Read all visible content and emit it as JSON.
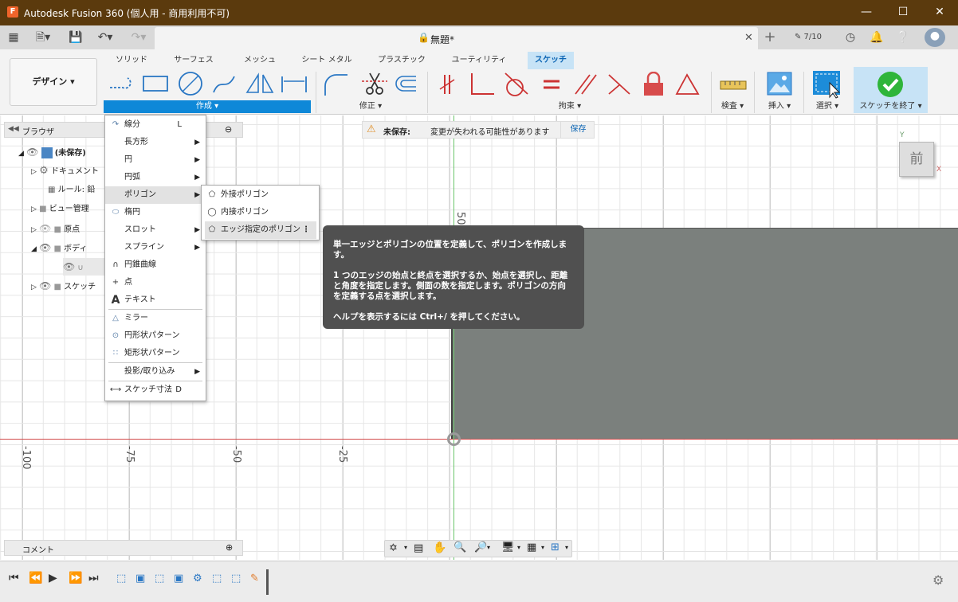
{
  "window": {
    "title": "Autodesk Fusion 360 (個人用 - 商用利用不可)"
  },
  "tabbar": {
    "doc_title": "無題*",
    "version": "7/10"
  },
  "ribbon": {
    "design_label": "デザイン",
    "tabs": [
      "ソリッド",
      "サーフェス",
      "メッシュ",
      "シート メタル",
      "プラスチック",
      "ユーティリティ",
      "スケッチ"
    ],
    "active_tab": "スケッチ",
    "groups": {
      "create": "作成",
      "modify": "修正",
      "constrain": "拘束",
      "inspect": "検査",
      "insert": "挿入",
      "select": "選択",
      "finish": "スケッチを終了"
    }
  },
  "browser": {
    "title": "ブラウザ",
    "items": [
      "(未保存)",
      "ドキュメント",
      "ルール: 鉛",
      "ビュー管理",
      "原点",
      "ボディ",
      "スケッチ"
    ]
  },
  "unsaved": {
    "label": "未保存:",
    "message": "変更が失われる可能性があります",
    "save": "保存"
  },
  "create_menu": [
    {
      "label": "線分",
      "key": "L"
    },
    {
      "label": "長方形",
      "sub": true
    },
    {
      "label": "円",
      "sub": true
    },
    {
      "label": "円弧",
      "sub": true
    },
    {
      "label": "ポリゴン",
      "sub": true
    },
    {
      "label": "楕円"
    },
    {
      "label": "スロット",
      "sub": true
    },
    {
      "label": "スプライン",
      "sub": true
    },
    {
      "label": "円錐曲線"
    },
    {
      "label": "点"
    },
    {
      "label": "テキスト"
    },
    {
      "label": "ミラー"
    },
    {
      "label": "円形状パターン"
    },
    {
      "label": "矩形状パターン"
    },
    {
      "label": "投影/取り込み",
      "sub": true
    },
    {
      "label": "スケッチ寸法",
      "key": "D"
    }
  ],
  "polygon_menu": [
    "外接ポリゴン",
    "内接ポリゴン",
    "エッジ指定のポリゴン"
  ],
  "tooltip": {
    "line1": "単一エッジとポリゴンの位置を定義して、ポリゴンを作成します。",
    "line2": "1 つのエッジの始点と終点を選択するか、始点を選択し、距離と角度を指定します。側面の数を指定します。ポリゴンの方向を定義する点を選択します。",
    "line3": "ヘルプを表示するには Ctrl+/ を押してください。"
  },
  "axes": {
    "x_ticks": [
      "-100",
      "-75",
      "-50",
      "-25"
    ],
    "y_tick": "50"
  },
  "viewcube": {
    "face": "前",
    "axis_y": "Y",
    "axis_x": "X"
  },
  "comments": {
    "label": "コメント"
  },
  "colors": {
    "titlebar": "#5b3a0d",
    "accent": "#0e88d8",
    "finish": "#2fb53a"
  }
}
